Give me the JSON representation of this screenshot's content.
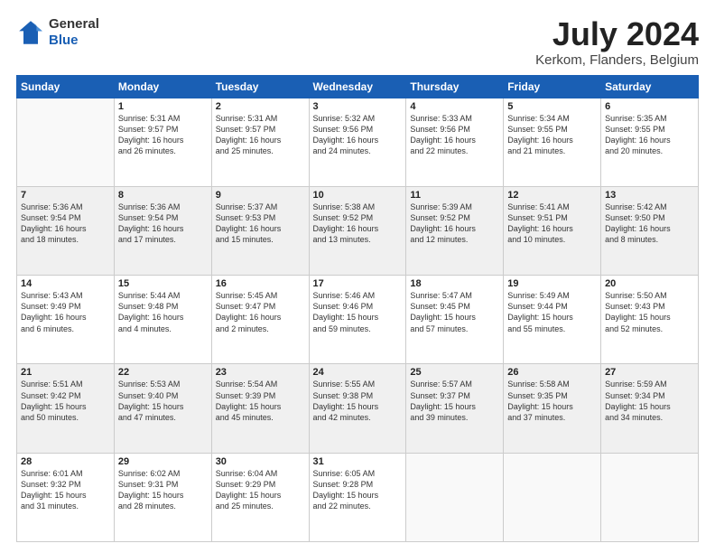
{
  "header": {
    "logo_line1": "General",
    "logo_line2": "Blue",
    "title": "July 2024",
    "subtitle": "Kerkom, Flanders, Belgium"
  },
  "weekdays": [
    "Sunday",
    "Monday",
    "Tuesday",
    "Wednesday",
    "Thursday",
    "Friday",
    "Saturday"
  ],
  "weeks": [
    [
      {
        "day": "",
        "info": ""
      },
      {
        "day": "1",
        "info": "Sunrise: 5:31 AM\nSunset: 9:57 PM\nDaylight: 16 hours\nand 26 minutes."
      },
      {
        "day": "2",
        "info": "Sunrise: 5:31 AM\nSunset: 9:57 PM\nDaylight: 16 hours\nand 25 minutes."
      },
      {
        "day": "3",
        "info": "Sunrise: 5:32 AM\nSunset: 9:56 PM\nDaylight: 16 hours\nand 24 minutes."
      },
      {
        "day": "4",
        "info": "Sunrise: 5:33 AM\nSunset: 9:56 PM\nDaylight: 16 hours\nand 22 minutes."
      },
      {
        "day": "5",
        "info": "Sunrise: 5:34 AM\nSunset: 9:55 PM\nDaylight: 16 hours\nand 21 minutes."
      },
      {
        "day": "6",
        "info": "Sunrise: 5:35 AM\nSunset: 9:55 PM\nDaylight: 16 hours\nand 20 minutes."
      }
    ],
    [
      {
        "day": "7",
        "info": "Sunrise: 5:36 AM\nSunset: 9:54 PM\nDaylight: 16 hours\nand 18 minutes."
      },
      {
        "day": "8",
        "info": "Sunrise: 5:36 AM\nSunset: 9:54 PM\nDaylight: 16 hours\nand 17 minutes."
      },
      {
        "day": "9",
        "info": "Sunrise: 5:37 AM\nSunset: 9:53 PM\nDaylight: 16 hours\nand 15 minutes."
      },
      {
        "day": "10",
        "info": "Sunrise: 5:38 AM\nSunset: 9:52 PM\nDaylight: 16 hours\nand 13 minutes."
      },
      {
        "day": "11",
        "info": "Sunrise: 5:39 AM\nSunset: 9:52 PM\nDaylight: 16 hours\nand 12 minutes."
      },
      {
        "day": "12",
        "info": "Sunrise: 5:41 AM\nSunset: 9:51 PM\nDaylight: 16 hours\nand 10 minutes."
      },
      {
        "day": "13",
        "info": "Sunrise: 5:42 AM\nSunset: 9:50 PM\nDaylight: 16 hours\nand 8 minutes."
      }
    ],
    [
      {
        "day": "14",
        "info": "Sunrise: 5:43 AM\nSunset: 9:49 PM\nDaylight: 16 hours\nand 6 minutes."
      },
      {
        "day": "15",
        "info": "Sunrise: 5:44 AM\nSunset: 9:48 PM\nDaylight: 16 hours\nand 4 minutes."
      },
      {
        "day": "16",
        "info": "Sunrise: 5:45 AM\nSunset: 9:47 PM\nDaylight: 16 hours\nand 2 minutes."
      },
      {
        "day": "17",
        "info": "Sunrise: 5:46 AM\nSunset: 9:46 PM\nDaylight: 15 hours\nand 59 minutes."
      },
      {
        "day": "18",
        "info": "Sunrise: 5:47 AM\nSunset: 9:45 PM\nDaylight: 15 hours\nand 57 minutes."
      },
      {
        "day": "19",
        "info": "Sunrise: 5:49 AM\nSunset: 9:44 PM\nDaylight: 15 hours\nand 55 minutes."
      },
      {
        "day": "20",
        "info": "Sunrise: 5:50 AM\nSunset: 9:43 PM\nDaylight: 15 hours\nand 52 minutes."
      }
    ],
    [
      {
        "day": "21",
        "info": "Sunrise: 5:51 AM\nSunset: 9:42 PM\nDaylight: 15 hours\nand 50 minutes."
      },
      {
        "day": "22",
        "info": "Sunrise: 5:53 AM\nSunset: 9:40 PM\nDaylight: 15 hours\nand 47 minutes."
      },
      {
        "day": "23",
        "info": "Sunrise: 5:54 AM\nSunset: 9:39 PM\nDaylight: 15 hours\nand 45 minutes."
      },
      {
        "day": "24",
        "info": "Sunrise: 5:55 AM\nSunset: 9:38 PM\nDaylight: 15 hours\nand 42 minutes."
      },
      {
        "day": "25",
        "info": "Sunrise: 5:57 AM\nSunset: 9:37 PM\nDaylight: 15 hours\nand 39 minutes."
      },
      {
        "day": "26",
        "info": "Sunrise: 5:58 AM\nSunset: 9:35 PM\nDaylight: 15 hours\nand 37 minutes."
      },
      {
        "day": "27",
        "info": "Sunrise: 5:59 AM\nSunset: 9:34 PM\nDaylight: 15 hours\nand 34 minutes."
      }
    ],
    [
      {
        "day": "28",
        "info": "Sunrise: 6:01 AM\nSunset: 9:32 PM\nDaylight: 15 hours\nand 31 minutes."
      },
      {
        "day": "29",
        "info": "Sunrise: 6:02 AM\nSunset: 9:31 PM\nDaylight: 15 hours\nand 28 minutes."
      },
      {
        "day": "30",
        "info": "Sunrise: 6:04 AM\nSunset: 9:29 PM\nDaylight: 15 hours\nand 25 minutes."
      },
      {
        "day": "31",
        "info": "Sunrise: 6:05 AM\nSunset: 9:28 PM\nDaylight: 15 hours\nand 22 minutes."
      },
      {
        "day": "",
        "info": ""
      },
      {
        "day": "",
        "info": ""
      },
      {
        "day": "",
        "info": ""
      }
    ]
  ]
}
